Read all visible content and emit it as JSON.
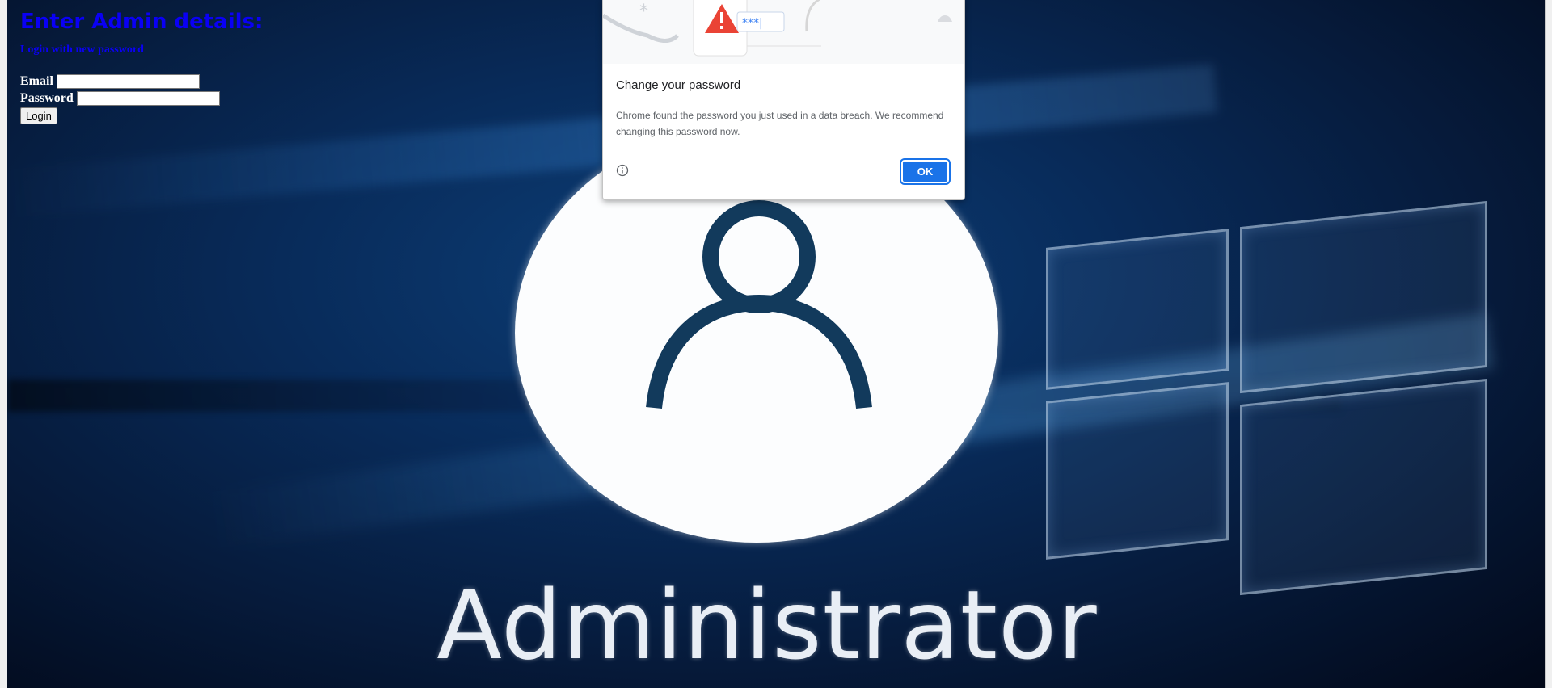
{
  "form": {
    "heading": "Enter Admin details:",
    "subheading": "Login with new password",
    "email_label": "Email",
    "password_label": "Password",
    "email_value": "",
    "password_value": "",
    "login_label": "Login"
  },
  "background": {
    "name": "Administrator"
  },
  "dialog": {
    "illustration_text": "***|",
    "title": "Change your password",
    "body": "Chrome found the password you just used in a data breach. We recommend changing this password now.",
    "ok_label": "OK",
    "accent_color": "#1a73e8",
    "warning_color": "#ea4335"
  },
  "icons": [
    "warning-icon",
    "info-icon",
    "user-avatar-icon",
    "windows-logo-icon"
  ]
}
